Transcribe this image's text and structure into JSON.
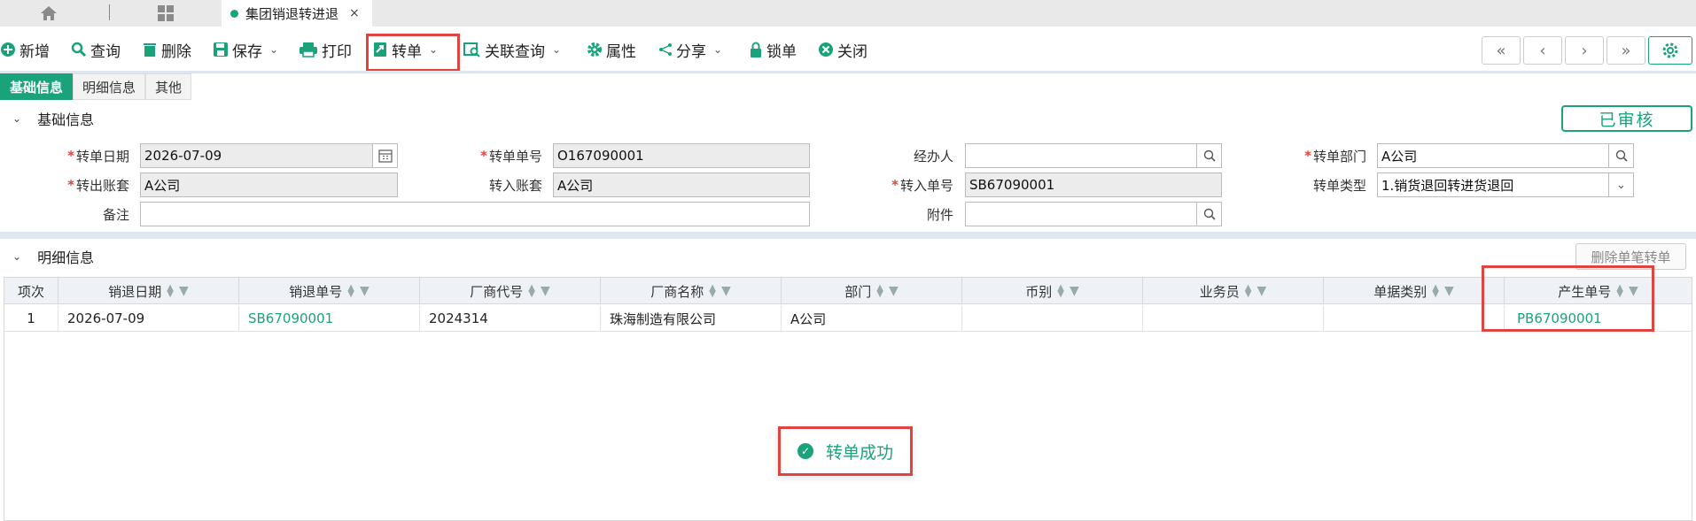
{
  "tabs": {
    "active_label": "集团销退转进退",
    "close_glyph": "×"
  },
  "toolbar": {
    "new": "新增",
    "query": "查询",
    "delete": "删除",
    "save": "保存",
    "print": "打印",
    "transfer": "转单",
    "related_query": "关联查询",
    "properties": "属性",
    "share": "分享",
    "lock": "锁单",
    "close": "关闭"
  },
  "subtabs": [
    "基础信息",
    "明细信息",
    "其他"
  ],
  "basic_section": {
    "title": "基础信息",
    "status_badge": "已审核"
  },
  "form": {
    "transfer_date_label": "转单日期",
    "transfer_date": "2026-07-09",
    "transfer_no_label": "转单单号",
    "transfer_no": "O167090001",
    "handler_label": "经办人",
    "handler": "",
    "transfer_dept_label": "转单部门",
    "transfer_dept": "A公司",
    "out_account_label": "转出账套",
    "out_account": "A公司",
    "in_account_label": "转入账套",
    "in_account": "A公司",
    "in_no_label": "转入单号",
    "in_no": "SB67090001",
    "transfer_type_label": "转单类型",
    "transfer_type": "1.销货退回转进货退回",
    "remark_label": "备注",
    "remark": "",
    "attachment_label": "附件",
    "attachment": ""
  },
  "detail_section": {
    "title": "明细信息",
    "delete_single_button": "删除单笔转单"
  },
  "grid": {
    "columns": [
      "项次",
      "销退日期",
      "销退单号",
      "厂商代号",
      "厂商名称",
      "部门",
      "币别",
      "业务员",
      "单据类别",
      "产生单号"
    ],
    "rows": [
      [
        "1",
        "2026-07-09",
        "SB67090001",
        "2024314",
        "珠海制造有限公司",
        "A公司",
        "",
        "",
        "",
        "PB67090001"
      ]
    ]
  },
  "toast": {
    "message": "转单成功"
  },
  "colors": {
    "accent": "#1aa37a",
    "highlight": "#e0443e"
  }
}
